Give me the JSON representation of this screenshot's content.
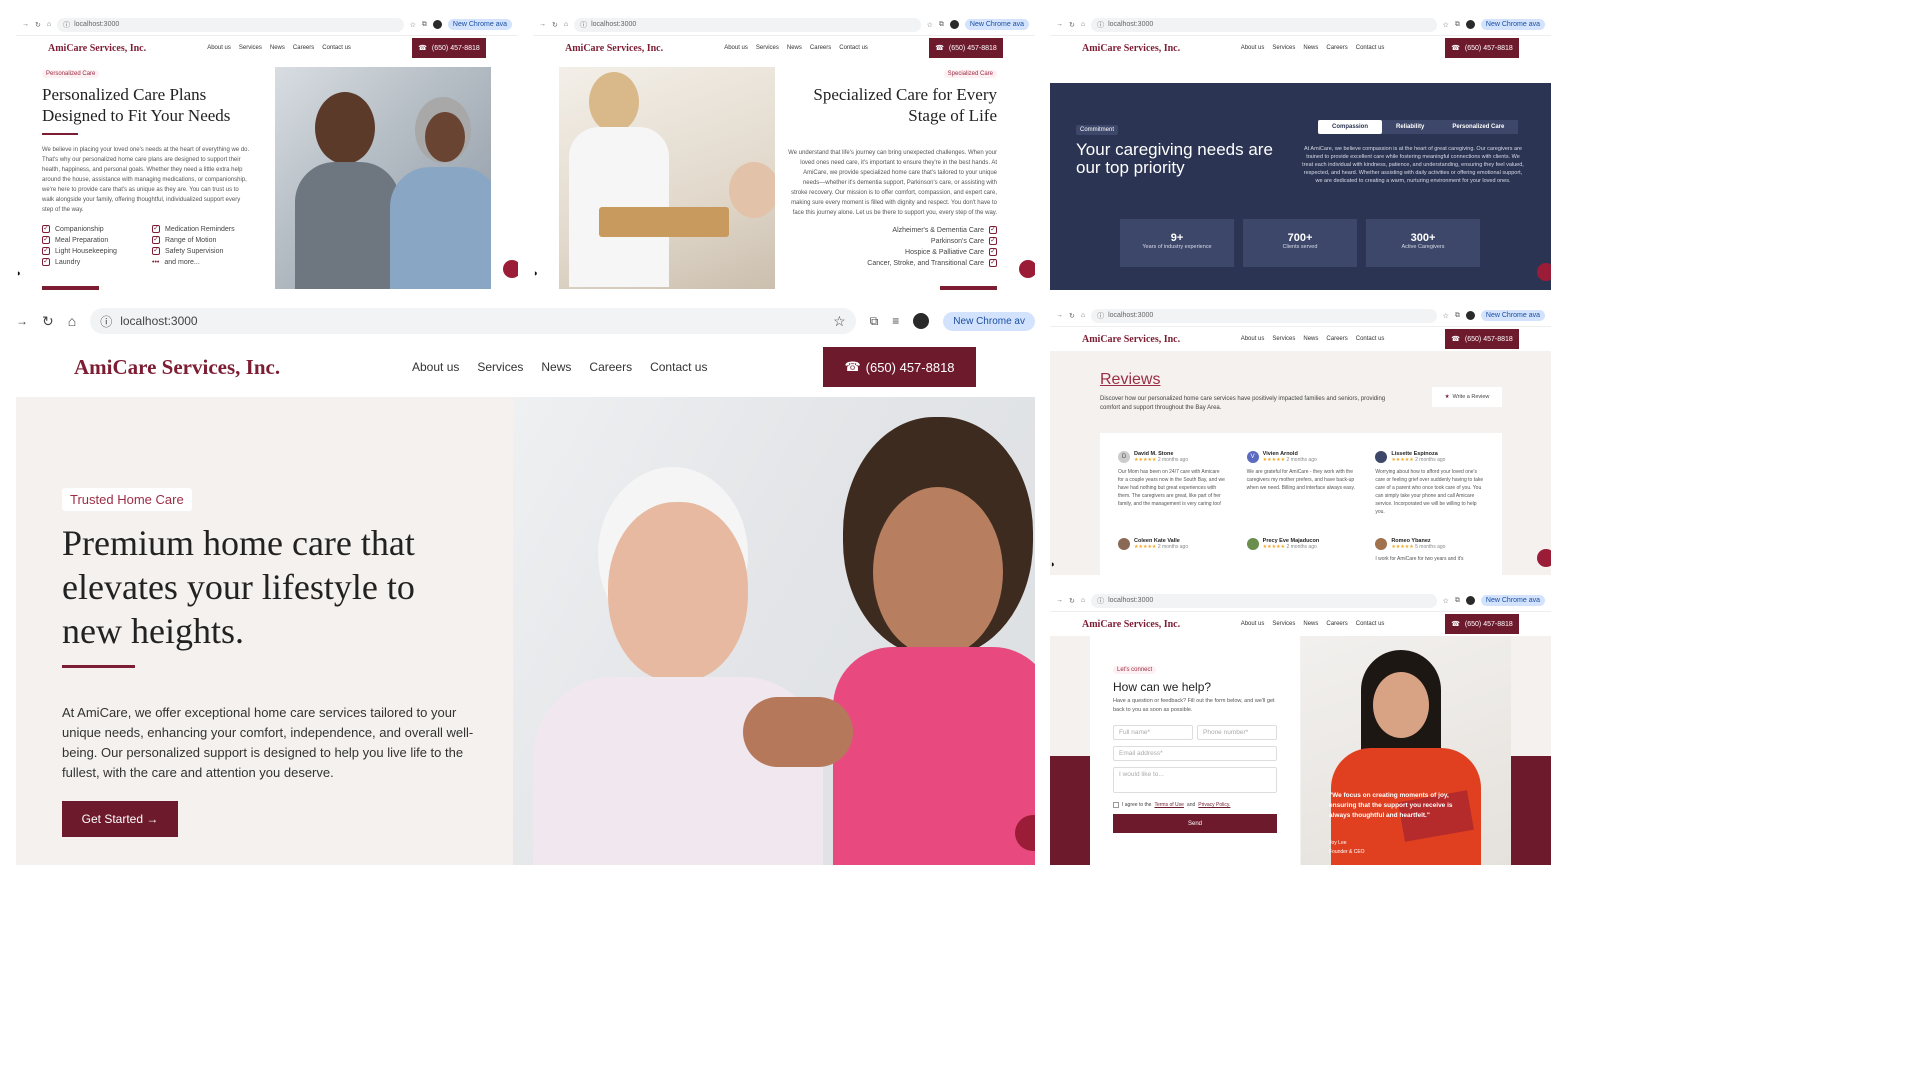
{
  "browser": {
    "url": "localhost:3000",
    "chrome_badge": "New Chrome av",
    "chrome_badge_small": "New Chrome ava"
  },
  "brand": {
    "name": "AmiCare Services, Inc.",
    "phone": "(650) 457-8818",
    "colors": {
      "primary": "#6d1a2c",
      "accent": "#9b2d45",
      "dark_navy": "#2b3452"
    }
  },
  "nav": [
    "About us",
    "Services",
    "News",
    "Careers",
    "Contact us"
  ],
  "icons": {
    "phone": "phone-icon",
    "star": "star-icon",
    "check": "checkbox-icon",
    "chat": "chat-icon"
  },
  "personalized": {
    "tag": "Personalized Care",
    "title": "Personalized Care Plans Designed to Fit Your Needs",
    "body": "We believe in placing your loved one's needs at the heart of everything we do. That's why our personalized home care plans are designed to support their health, happiness, and personal goals. Whether they need a little extra help around the house, assistance with managing medications, or companionship, we're here to provide care that's as unique as they are. You can trust us to walk alongside your family, offering thoughtful, individualized support every step of the way.",
    "services": [
      "Companionship",
      "Medication Reminders",
      "Meal Preparation",
      "Range of Motion",
      "Light Housekeeping",
      "Safety Supervision",
      "Laundry",
      "and more..."
    ]
  },
  "specialized": {
    "tag": "Specialized Care",
    "title": "Specialized Care for Every Stage of Life",
    "body": "We understand that life's journey can bring unexpected challenges. When your loved ones need care, it's important to ensure they're in the best hands. At AmiCare, we provide specialized home care that's tailored to your unique needs—whether it's dementia support, Parkinson's care, or assisting with stroke recovery. Our mission is to offer comfort, compassion, and expert care, making sure every moment is filled with dignity and respect. You don't have to face this journey alone. Let us be there to support you, every step of the way.",
    "services": [
      "Alzheimer's & Dementia Care",
      "Parkinson's Care",
      "Hospice & Palliative Care",
      "Cancer, Stroke, and Transitional Care"
    ]
  },
  "commitment": {
    "tag": "Commitment",
    "title": "Your caregiving needs are our top priority",
    "tabs": [
      "Compassion",
      "Reliability",
      "Personalized Care"
    ],
    "body": "At AmiCare, we believe compassion is at the heart of great caregiving. Our caregivers are trained to provide excellent care while fostering meaningful connections with clients. We treat each individual with kindness, patience, and understanding, ensuring they feel valued, respected, and heard. Whether assisting with daily activities or offering emotional support, we are dedicated to creating a warm, nurturing environment for your loved ones.",
    "stats": [
      {
        "value": "9+",
        "label": "Years of industry experience"
      },
      {
        "value": "700+",
        "label": "Clients served"
      },
      {
        "value": "300+",
        "label": "Active Caregivers"
      }
    ]
  },
  "hero": {
    "tag": "Trusted Home Care",
    "title": "Premium home care that elevates your lifestyle to new heights.",
    "body": "At AmiCare, we offer exceptional home care services tailored to your unique needs, enhancing your comfort, independence, and overall well-being. Our personalized support is designed to help you live life to the fullest, with the care and attention you deserve.",
    "cta": "Get Started →"
  },
  "reviews": {
    "title": "Reviews",
    "subtitle": "Discover how our personalized home care services have positively impacted families and seniors, providing comfort and support throughout the Bay Area.",
    "write_button": "Write a Review",
    "items": [
      {
        "initial": "D",
        "name": "David M. Stone",
        "stars": "★★★★★",
        "when": "2 months ago",
        "text": "Our Mom has been on 24/7 care with Amicare for a couple years now in the South Bay, and we have had nothing but great experiences with them. The caregivers are great, like part of her family, and the management is very caring too!"
      },
      {
        "initial": "V",
        "name": "Vivien Arnold",
        "stars": "★★★★★",
        "when": "2 months ago",
        "text": "We are grateful for AmiCare - they work with the caregivers my mother prefers, and have back-up when we need. Billing and interface always easy."
      },
      {
        "initial": "L",
        "name": "Lissette Espinoza",
        "stars": "★★★★★",
        "when": "2 months ago",
        "text": "Worrying about how to afford your loved one's care or feeling grief over suddenly having to take care of a parent who once took care of you. You can simply take your phone and call Amicare service. Incorporated we will be willing to help you."
      },
      {
        "initial": "C",
        "name": "Coleen Kate Valle",
        "stars": "★★★★★",
        "when": "2 months ago",
        "text": ""
      },
      {
        "initial": "P",
        "name": "Precy Eve Majaducon",
        "stars": "★★★★★",
        "when": "2 months ago",
        "text": ""
      },
      {
        "initial": "R",
        "name": "Romeo Ybanez",
        "stars": "★★★★★",
        "when": "5 months ago",
        "text": "I work for AmiCare for two years and it's"
      }
    ]
  },
  "contact": {
    "tag": "Let's connect",
    "title": "How can we help?",
    "intro": "Have a question or feedback? Fill out the form below, and we'll get back to you as soon as possible.",
    "full_name": "Full name*",
    "phone": "Phone number*",
    "email": "Email address*",
    "message": "I would like to...",
    "agree_prefix": "I agree to the",
    "terms": "Terms of Use",
    "and": "and",
    "privacy": "Privacy Policy.",
    "send": "Send",
    "quote": "\"We focus on creating moments of joy, ensuring that the support you receive is always thoughtful and heartfelt.\"",
    "founder_name": "Joy Lee",
    "founder_title": "Founder & CEO"
  }
}
